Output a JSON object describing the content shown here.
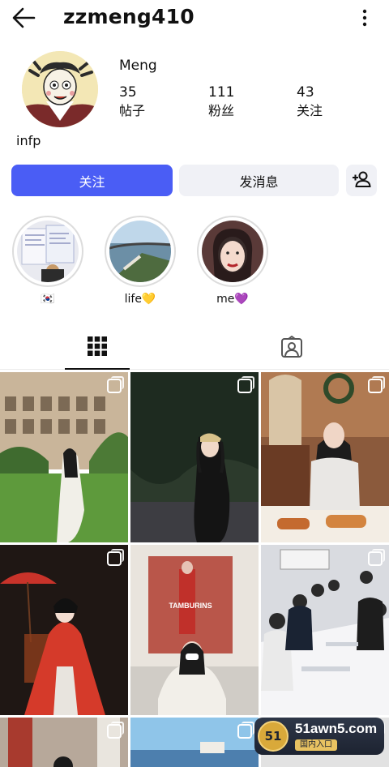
{
  "header": {
    "username": "zzmeng410"
  },
  "profile": {
    "display_name": "Meng",
    "bio": "infp",
    "stats": [
      {
        "value": "35",
        "label": "帖子"
      },
      {
        "value": "111",
        "label": "粉丝"
      },
      {
        "value": "43",
        "label": "关注"
      }
    ]
  },
  "actions": {
    "follow_label": "关注",
    "message_label": "发消息"
  },
  "highlights": [
    {
      "label": "🇰🇷"
    },
    {
      "label": "life💛"
    },
    {
      "label": "me💜"
    }
  ],
  "watermark": {
    "logo_text": "51",
    "title": "51awn5.com",
    "subtitle": "国内入口"
  },
  "colors": {
    "accent": "#4a5df5",
    "secondary_button": "#f0f1f6"
  }
}
